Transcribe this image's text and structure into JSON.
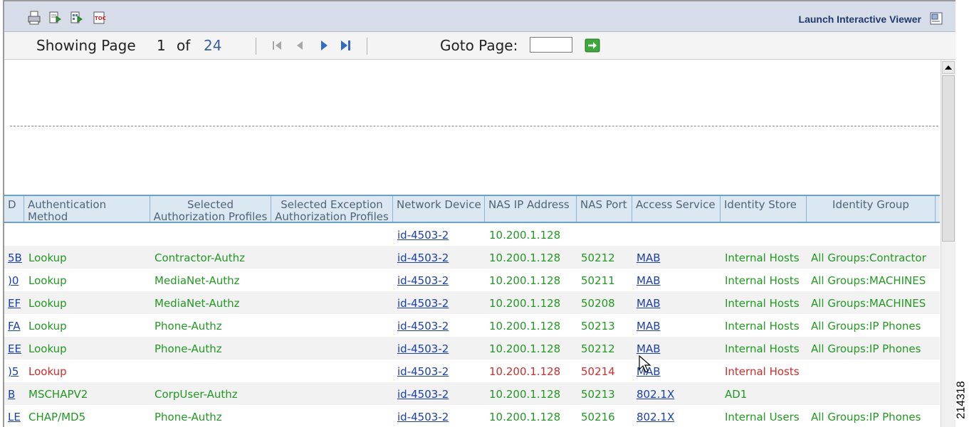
{
  "toolbar": {
    "launch_label": "Launch Interactive Viewer"
  },
  "pager": {
    "showing_label": "Showing Page",
    "current_page": "1",
    "of_label": "of",
    "total_pages": "24",
    "goto_label": "Goto Page:",
    "goto_value": ""
  },
  "table": {
    "headers": [
      {
        "line1": "D",
        "line2": ""
      },
      {
        "line1": "Authentication Method",
        "line2": ""
      },
      {
        "line1": "Selected",
        "line2": "Authorization Profiles"
      },
      {
        "line1": "Selected Exception",
        "line2": "Authorization Profiles"
      },
      {
        "line1": "Network Device",
        "line2": ""
      },
      {
        "line1": "NAS IP Address",
        "line2": ""
      },
      {
        "line1": "NAS Port",
        "line2": ""
      },
      {
        "line1": "Access Service",
        "line2": ""
      },
      {
        "line1": "Identity Store",
        "line2": ""
      },
      {
        "line1": "Identity Group",
        "line2": ""
      }
    ],
    "rows": [
      {
        "id": "",
        "method": "",
        "profile": "",
        "exception": "",
        "device": "id-4503-2",
        "ip": "10.200.1.128",
        "port": "",
        "service": "",
        "store": "",
        "group": "",
        "status": "pass"
      },
      {
        "id": "5B",
        "method": "Lookup",
        "profile": "Contractor-Authz",
        "exception": "",
        "device": "id-4503-2",
        "ip": "10.200.1.128",
        "port": "50212",
        "service": "MAB",
        "store": "Internal Hosts",
        "group": "All Groups:Contractor",
        "status": "pass"
      },
      {
        "id": ")0",
        "method": "Lookup",
        "profile": "MediaNet-Authz",
        "exception": "",
        "device": "id-4503-2",
        "ip": "10.200.1.128",
        "port": "50211",
        "service": "MAB",
        "store": "Internal Hosts",
        "group": "All Groups:MACHINES",
        "status": "pass"
      },
      {
        "id": "EF",
        "method": "Lookup",
        "profile": "MediaNet-Authz",
        "exception": "",
        "device": "id-4503-2",
        "ip": "10.200.1.128",
        "port": "50208",
        "service": "MAB",
        "store": "Internal Hosts",
        "group": "All Groups:MACHINES",
        "status": "pass"
      },
      {
        "id": "FA",
        "method": "Lookup",
        "profile": "Phone-Authz",
        "exception": "",
        "device": "id-4503-2",
        "ip": "10.200.1.128",
        "port": "50213",
        "service": "MAB",
        "store": "Internal Hosts",
        "group": "All Groups:IP Phones",
        "status": "pass"
      },
      {
        "id": "EE",
        "method": "Lookup",
        "profile": "Phone-Authz",
        "exception": "",
        "device": "id-4503-2",
        "ip": "10.200.1.128",
        "port": "50212",
        "service": "MAB",
        "store": "Internal Hosts",
        "group": "All Groups:IP Phones",
        "status": "pass"
      },
      {
        "id": ")5",
        "method": "Lookup",
        "profile": "",
        "exception": "",
        "device": "id-4503-2",
        "ip": "10.200.1.128",
        "port": "50214",
        "service": "MAB",
        "store": "Internal Hosts",
        "group": "",
        "status": "fail"
      },
      {
        "id": "B",
        "method": "MSCHAPV2",
        "profile": "CorpUser-Authz",
        "exception": "",
        "device": "id-4503-2",
        "ip": "10.200.1.128",
        "port": "50213",
        "service": "802.1X",
        "store": "AD1",
        "group": "",
        "status": "pass"
      },
      {
        "id": "LE",
        "method": "CHAP/MD5",
        "profile": "Phone-Authz",
        "exception": "",
        "device": "id-4503-2",
        "ip": "10.200.1.128",
        "port": "50216",
        "service": "802.1X",
        "store": "Internal Users",
        "group": "All Groups:IP Phones",
        "status": "pass"
      }
    ]
  },
  "figure_number": "214318",
  "colors": {
    "pass": "#1f9b1f",
    "fail": "#d42b2b",
    "link": "#1a3fb0",
    "header_bg": "#dce8f1"
  },
  "icons": [
    "print-icon",
    "export-icon",
    "export-data-icon",
    "toc-icon",
    "launch-viewer-icon",
    "first-page-icon",
    "previous-page-icon",
    "next-page-icon",
    "last-page-icon",
    "go-arrow-icon"
  ]
}
